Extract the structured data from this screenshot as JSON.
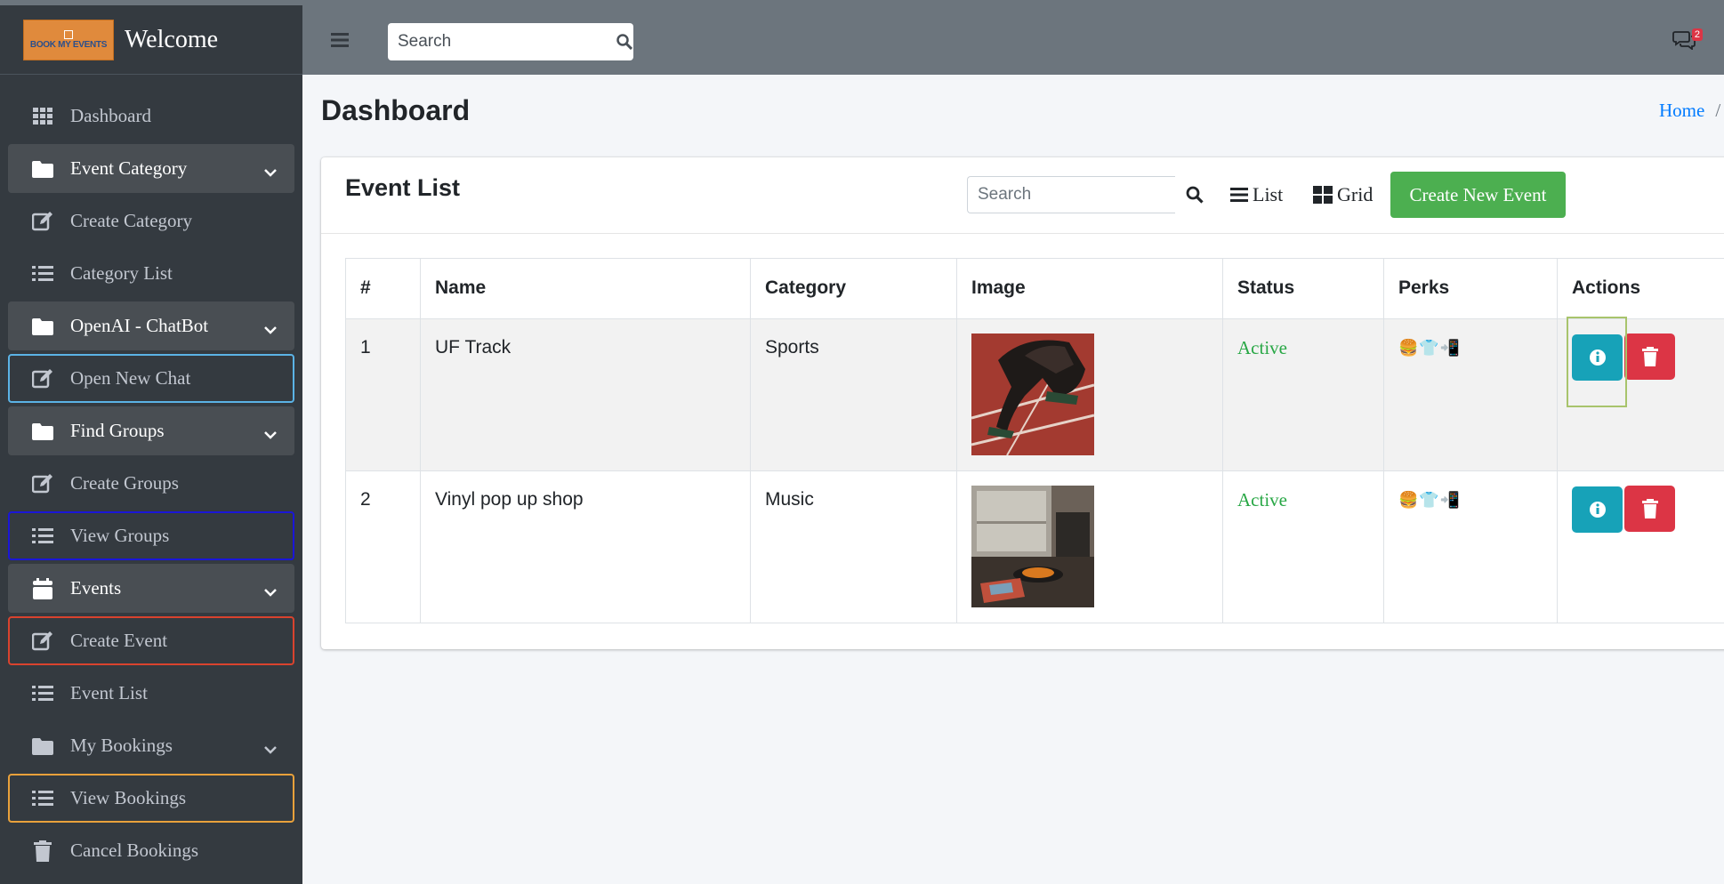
{
  "brand": {
    "logo_text": "BOOK MY EVENTS",
    "title": "Welcome"
  },
  "sidebar": {
    "items": [
      {
        "label": "Dashboard",
        "icon": "grid-icon"
      },
      {
        "label": "Event Category",
        "icon": "folder-icon",
        "expandable": true
      },
      {
        "label": "Create Category",
        "icon": "edit-icon"
      },
      {
        "label": "Category List",
        "icon": "list-icon"
      },
      {
        "label": "OpenAI - ChatBot",
        "icon": "folder-icon",
        "expandable": true
      },
      {
        "label": "Open New Chat",
        "icon": "edit-icon"
      },
      {
        "label": "Find Groups",
        "icon": "folder-icon",
        "expandable": true
      },
      {
        "label": "Create Groups",
        "icon": "edit-icon"
      },
      {
        "label": "View Groups",
        "icon": "list-icon"
      },
      {
        "label": "Events",
        "icon": "calendar-icon",
        "expandable": true
      },
      {
        "label": "Create Event",
        "icon": "edit-icon"
      },
      {
        "label": "Event List",
        "icon": "list-icon"
      },
      {
        "label": "My Bookings",
        "icon": "folder-icon",
        "expandable": true
      },
      {
        "label": "View Bookings",
        "icon": "list-icon"
      },
      {
        "label": "Cancel Bookings",
        "icon": "trash-icon"
      }
    ]
  },
  "header": {
    "search_placeholder": "Search",
    "notifications_count": "2"
  },
  "page": {
    "title": "Dashboard",
    "breadcrumb_home": "Home",
    "breadcrumb_sep": "/"
  },
  "card": {
    "title": "Event List",
    "search_placeholder": "Search",
    "list_label": "List",
    "grid_label": "Grid",
    "create_label": "Create New Event"
  },
  "table": {
    "headers": [
      "#",
      "Name",
      "Category",
      "Image",
      "Status",
      "Perks",
      "Actions"
    ],
    "rows": [
      {
        "num": "1",
        "name": "UF Track",
        "category": "Sports",
        "image": "track-runner-photo",
        "status": "Active",
        "perks": "🍔👕📲"
      },
      {
        "num": "2",
        "name": "Vinyl pop up shop",
        "category": "Music",
        "image": "vinyl-shop-photo",
        "status": "Active",
        "perks": "🍔👕📲"
      }
    ]
  },
  "colors": {
    "sidebar_bg": "#343a40",
    "topbar_bg": "#6c757d",
    "create_btn": "#4caf50",
    "info_btn": "#17a2b8",
    "delete_btn": "#dc3545",
    "status_active": "#28a745",
    "link": "#007bff"
  }
}
